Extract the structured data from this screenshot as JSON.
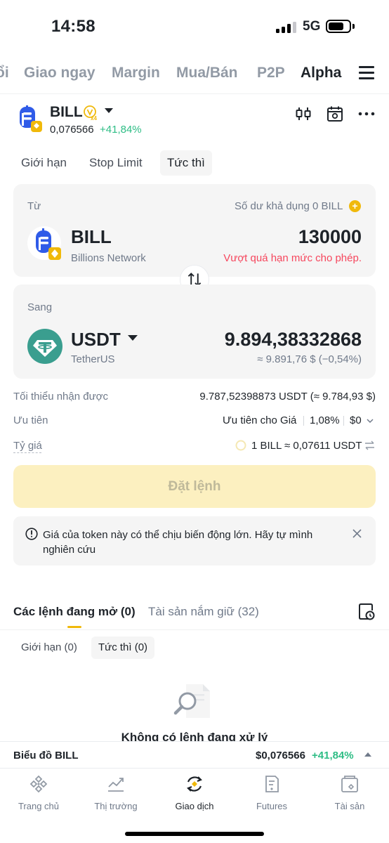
{
  "status_bar": {
    "time": "14:58",
    "network": "5G"
  },
  "top_tabs": [
    {
      "label": "ổi"
    },
    {
      "label": "Giao ngay"
    },
    {
      "label": "Margin"
    },
    {
      "label": "Mua/Bán"
    },
    {
      "label": "P2P"
    },
    {
      "label": "Alpha"
    }
  ],
  "pair": {
    "symbol": "BILL",
    "price": "0,076566",
    "change": "+41,84%",
    "badge": "x4"
  },
  "order_tabs": [
    {
      "label": "Giới hạn"
    },
    {
      "label": "Stop Limit"
    },
    {
      "label": "Tức thì"
    }
  ],
  "from": {
    "label": "Từ",
    "balance": "Số dư khả dụng 0 BILL",
    "symbol": "BILL",
    "name": "Billions Network",
    "amount": "130000",
    "error": "Vượt quá hạn mức cho phép."
  },
  "to": {
    "label": "Sang",
    "symbol": "USDT",
    "name": "TetherUS",
    "amount": "9.894,38332868",
    "approx": "≈ 9.891,76 $ (−0,54%)"
  },
  "info": {
    "min_receive_label": "Tối thiểu nhận được",
    "min_receive_value": "9.787,52398873 USDT (≈ 9.784,93 $)",
    "priority_label": "Ưu tiên",
    "priority_value": "Ưu tiên cho Giá",
    "priority_pct": "1,08%",
    "priority_fee": "$0",
    "rate_label": "Tỷ giá",
    "rate_value": "1 BILL ≈ 0,07611 USDT"
  },
  "place_order": "Đặt lệnh",
  "warning": "Giá của token này có thể chịu biến động lớn. Hãy tự mình nghiên cứu",
  "bottom_tabs": [
    {
      "label": "Các lệnh đang mở (0)"
    },
    {
      "label": "Tài sản nắm giữ (32)"
    }
  ],
  "sub_tabs": [
    {
      "label": "Giới hạn (0)"
    },
    {
      "label": "Tức thì (0)"
    }
  ],
  "empty_text": "Không có lệnh đang xử lý",
  "chart_bar": {
    "label": "Biểu đồ BILL",
    "price": "$0,076566",
    "change": "+41,84%"
  },
  "nav": [
    {
      "label": "Trang chủ",
      "icon": "home-icon"
    },
    {
      "label": "Thị trường",
      "icon": "markets-icon"
    },
    {
      "label": "Giao dịch",
      "icon": "trade-icon"
    },
    {
      "label": "Futures",
      "icon": "futures-icon"
    },
    {
      "label": "Tài sản",
      "icon": "wallet-icon"
    }
  ],
  "colors": {
    "accent": "#f0b90b",
    "positive": "#2ebd85",
    "negative": "#f6465d",
    "bill_blue": "#2f5be8",
    "usdt_teal": "#3a9e8f"
  }
}
